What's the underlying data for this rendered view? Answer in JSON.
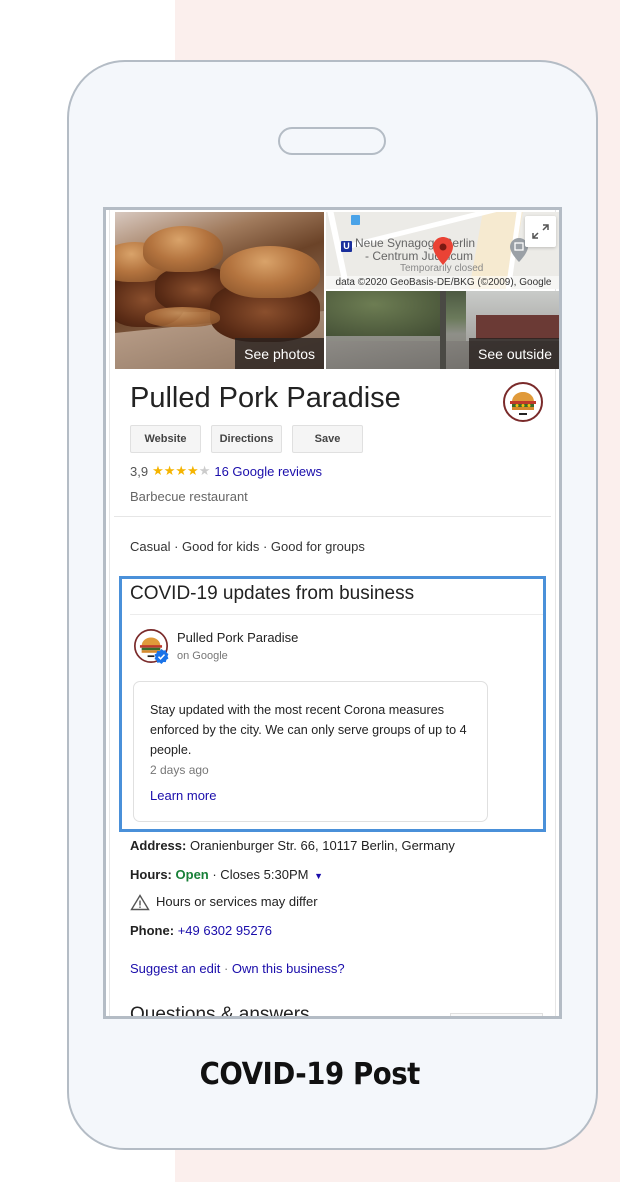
{
  "caption": "COVID-19 Post",
  "colors": {
    "accent_highlight": "#4a90d9",
    "link": "#1a0dab",
    "open_green": "#188038",
    "star": "#f5b400",
    "background_pink": "#fbefed",
    "phone_fill": "#f4f7fb",
    "phone_stroke": "#b4bcc5"
  },
  "hero": {
    "see_photos_label": "See photos",
    "see_outside_label": "See outside",
    "map": {
      "place_name_line1": "Neue Synagoge Berlin",
      "place_name_line2": "- Centrum Judaicum",
      "place_status": "Temporarily closed",
      "attribution": "data ©2020 GeoBasis-DE/BKG (©2009), Google",
      "transit_icon": "U",
      "expand_icon": "expand-icon"
    }
  },
  "business": {
    "name": "Pulled Pork Paradise",
    "buttons": [
      "Website",
      "Directions",
      "Save"
    ],
    "rating": "3,9",
    "rating_value": 3.9,
    "stars_filled": 4,
    "stars_total": 5,
    "reviews_link": "16 Google reviews",
    "category": "Barbecue restaurant",
    "tags": "Casual · Good for kids · Good for groups"
  },
  "covid": {
    "title": "COVID-19 updates from business",
    "author": "Pulled Pork Paradise",
    "author_sub": "on Google",
    "post_text": "Stay updated with the most recent Corona measures enforced by the city. We can only serve groups of up to 4 people.",
    "post_time": "2 days ago",
    "learn_more": "Learn more"
  },
  "details": {
    "address_label": "Address:",
    "address_value": " Oranienburger Str. 66, 10117 Berlin, Germany",
    "hours_label": "Hours:",
    "hours_status": "Open",
    "hours_detail": " · Closes 5:30PM",
    "hours_warning": "Hours or services may differ",
    "phone_label": "Phone:",
    "phone_value": "+49 6302 95276",
    "suggest_edit": "Suggest an edit",
    "separator": " · ",
    "own_business": "Own this business?"
  },
  "qa": {
    "title": "Questions & answers"
  }
}
